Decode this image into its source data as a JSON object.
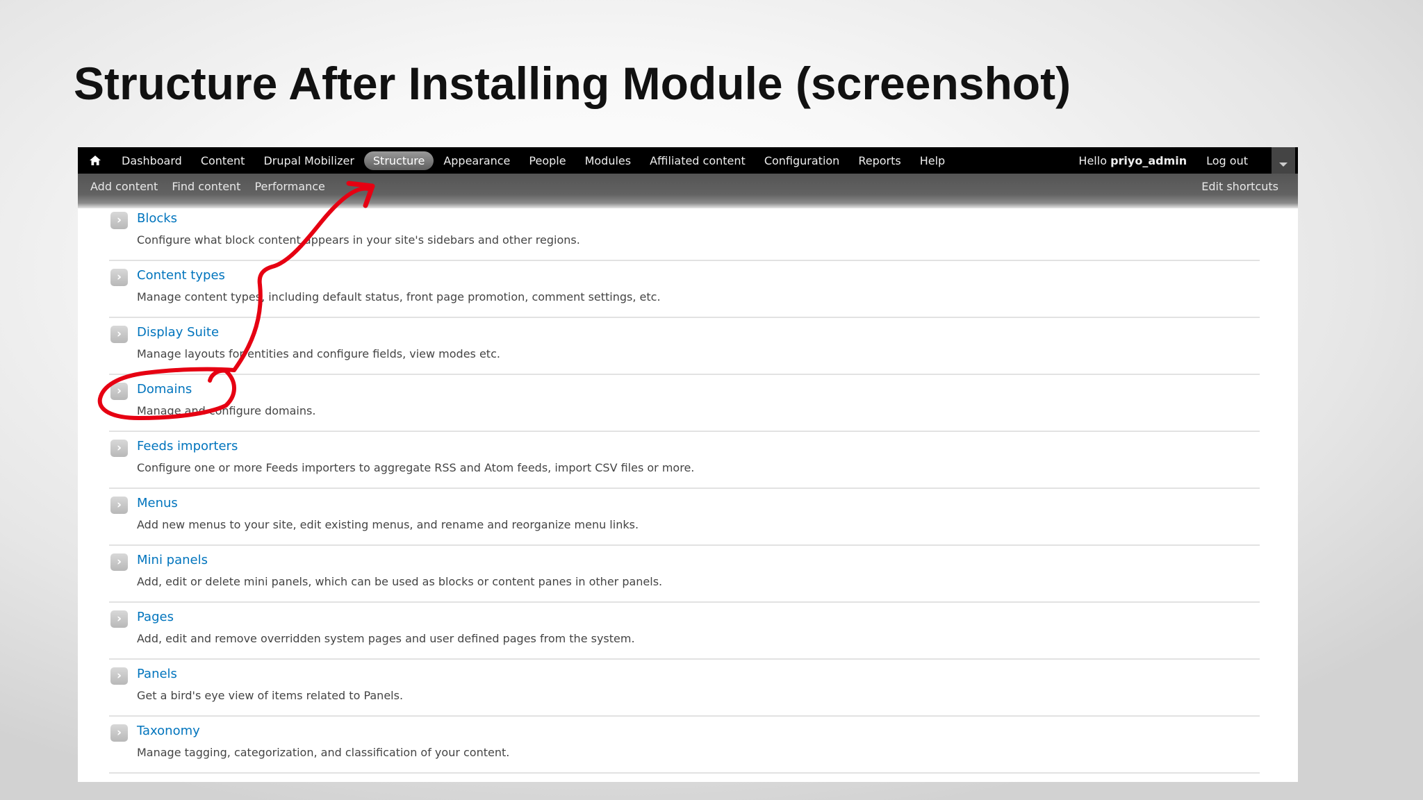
{
  "slide": {
    "title": "Structure After Installing Module (screenshot)"
  },
  "toolbar": {
    "items": [
      {
        "label": "Dashboard"
      },
      {
        "label": "Content"
      },
      {
        "label": "Drupal Mobilizer"
      },
      {
        "label": "Structure",
        "active": true
      },
      {
        "label": "Appearance"
      },
      {
        "label": "People"
      },
      {
        "label": "Modules"
      },
      {
        "label": "Affiliated content"
      },
      {
        "label": "Configuration"
      },
      {
        "label": "Reports"
      },
      {
        "label": "Help"
      }
    ],
    "hello_label": "Hello",
    "username": "priyo_admin",
    "logout_label": "Log out"
  },
  "shortcuts": {
    "items": [
      {
        "label": "Add content"
      },
      {
        "label": "Find content"
      },
      {
        "label": "Performance"
      }
    ],
    "edit_label": "Edit shortcuts"
  },
  "structure_list": [
    {
      "title": "Blocks",
      "description": "Configure what block content appears in your site's sidebars and other regions."
    },
    {
      "title": "Content types",
      "description": "Manage content types, including default status, front page promotion, comment settings, etc."
    },
    {
      "title": "Display Suite",
      "description": "Manage layouts for entities and configure fields, view modes etc."
    },
    {
      "title": "Domains",
      "description": "Manage and configure domains."
    },
    {
      "title": "Feeds importers",
      "description": "Configure one or more Feeds importers to aggregate RSS and Atom feeds, import CSV files or more."
    },
    {
      "title": "Menus",
      "description": "Add new menus to your site, edit existing menus, and rename and reorganize menu links."
    },
    {
      "title": "Mini panels",
      "description": "Add, edit or delete mini panels, which can be used as blocks or content panes in other panels."
    },
    {
      "title": "Pages",
      "description": "Add, edit and remove overridden system pages and user defined pages from the system."
    },
    {
      "title": "Panels",
      "description": "Get a bird's eye view of items related to Panels."
    },
    {
      "title": "Taxonomy",
      "description": "Manage tagging, categorization, and classification of your content."
    }
  ],
  "colors": {
    "link": "#0074bd",
    "annotation": "#e60012",
    "toolbar_bg": "#000000",
    "shortcuts_bg": "#5a5a5a"
  },
  "icons": {
    "home": "home-icon",
    "item_arrow": "chevron-right-icon",
    "drawer": "triangle-down-icon"
  }
}
